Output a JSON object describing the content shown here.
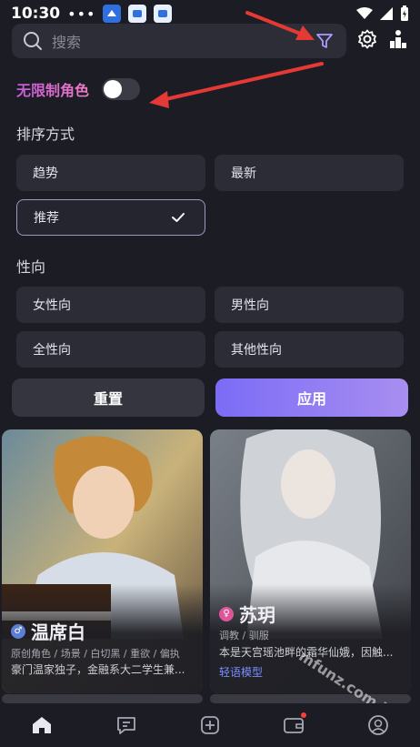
{
  "status": {
    "time": "10:30",
    "dots": "•••"
  },
  "search": {
    "placeholder": "搜索"
  },
  "unlimited": {
    "label": "无限制角色",
    "enabled": false
  },
  "sort": {
    "title": "排序方式",
    "options": [
      "趋势",
      "最新",
      "推荐"
    ],
    "selected": "推荐"
  },
  "orientation": {
    "title": "性向",
    "options": [
      "女性向",
      "男性向",
      "全性向",
      "其他性向"
    ]
  },
  "actions": {
    "reset": "重置",
    "apply": "应用"
  },
  "cards": [
    {
      "name": "温席白",
      "gender": "male",
      "tags": "原创角色 / 场景 / 白切黑 / 重欲 / 偏执",
      "desc": "豪门温家独子，金融系大二学生兼..."
    },
    {
      "name": "苏玥",
      "gender": "female",
      "tags": "调教 / 驯服",
      "desc": "本是天宫瑶池畔的霜华仙娥，因触...",
      "model": "轻语模型"
    }
  ],
  "tabs": [
    "home-icon",
    "chat-icon",
    "create-icon",
    "wallet-icon",
    "profile-icon"
  ],
  "watermark": "mfunz.com 魔趣网",
  "colors": {
    "accent": "#8b7cf6",
    "selected_border": "#9a99c0",
    "arrow": "#e53935",
    "unlimited_label": "#d66bd0"
  }
}
